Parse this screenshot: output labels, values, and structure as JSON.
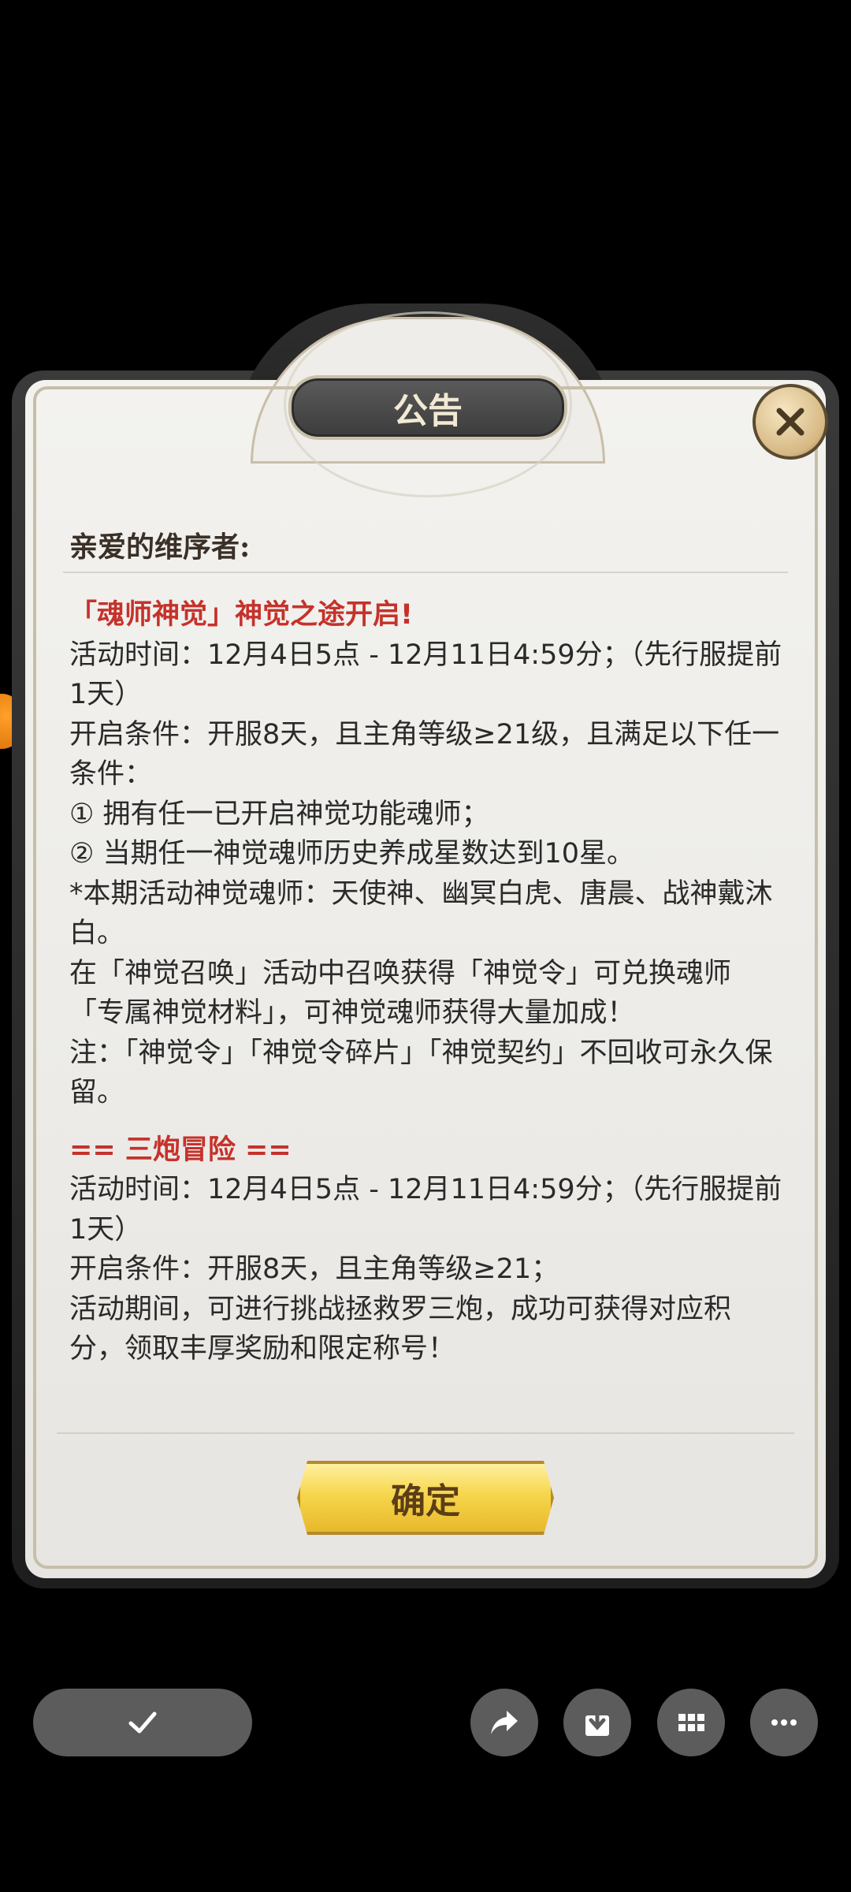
{
  "dialog": {
    "title": "公告",
    "greeting": "亲爱的维序者:",
    "confirm_label": "确定"
  },
  "announcement": {
    "event1_title": "「魂师神觉」神觉之途开启!",
    "event1_lines": [
      "活动时间：12月4日5点 - 12月11日4:59分；（先行服提前1天）",
      "开启条件：开服8天，且主角等级≥21级，且满足以下任一条件：",
      "① 拥有任一已开启神觉功能魂师；",
      "② 当期任一神觉魂师历史养成星数达到10星。",
      "*本期活动神觉魂师：天使神、幽冥白虎、唐晨、战神戴沐白。",
      "在「神觉召唤」活动中召唤获得「神觉令」可兑换魂师「专属神觉材料」，可神觉魂师获得大量加成！",
      "注：「神觉令」「神觉令碎片」「神觉契约」不回收可永久保留。"
    ],
    "event2_title": "== 三炮冒险 ==",
    "event2_lines": [
      "活动时间：12月4日5点 - 12月11日4:59分；（先行服提前1天）",
      "开启条件：开服8天，且主角等级≥21；",
      "活动期间，可进行挑战拯救罗三炮，成功可获得对应积分，领取丰厚奖励和限定称号！"
    ]
  },
  "icons": {
    "close": "close-icon",
    "check": "check-icon",
    "share": "share-icon",
    "download": "download-icon",
    "grid": "grid-icon",
    "more": "more-icon"
  },
  "colors": {
    "accent_red": "#c5322b",
    "confirm_gold": "#f6d64b",
    "panel_bg": "#efede9"
  }
}
